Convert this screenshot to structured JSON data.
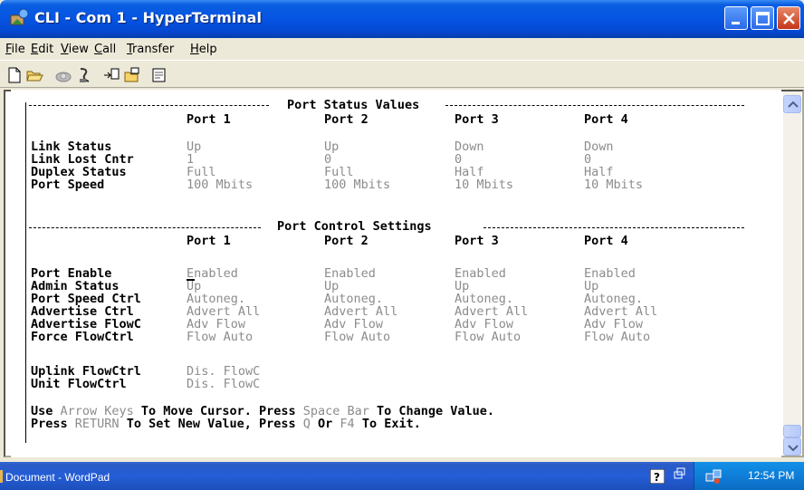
{
  "window": {
    "title": "CLI - Com 1 - HyperTerminal"
  },
  "menu": [
    {
      "label": "File",
      "key": "F",
      "rest": "ile"
    },
    {
      "label": "Edit",
      "key": "E",
      "rest": "dit"
    },
    {
      "label": "View",
      "key": "V",
      "rest": "iew"
    },
    {
      "label": "Call",
      "key": "C",
      "rest": "all"
    },
    {
      "label": "Transfer",
      "key": "T",
      "rest": "ransfer"
    },
    {
      "label": "Help",
      "key": "H",
      "rest": "elp"
    }
  ],
  "toolbar": {
    "icons": [
      "new-icon",
      "open-icon",
      "connect-icon",
      "disconnect-icon",
      "send-icon",
      "receive-icon",
      "properties-icon"
    ]
  },
  "terminal": {
    "status_header": "Port Status Values",
    "status_ports": [
      "Port 1",
      "Port 2",
      "Port 3",
      "Port 4"
    ],
    "status_rows": [
      {
        "label": "Link Status",
        "values": [
          "Up",
          "Up",
          "Down",
          "Down"
        ]
      },
      {
        "label": "Link Lost Cntr",
        "values": [
          "1",
          "0",
          "0",
          "0"
        ]
      },
      {
        "label": "Duplex Status",
        "values": [
          "Full",
          "Full",
          "Half",
          "Half"
        ]
      },
      {
        "label": "Port Speed",
        "values": [
          "100 Mbits",
          "100 Mbits",
          "10 Mbits",
          "10 Mbits"
        ]
      }
    ],
    "control_header": "Port Control Settings",
    "control_ports": [
      "Port 1",
      "Port 2",
      "Port 3",
      "Port 4"
    ],
    "control_rows": [
      {
        "label": "Port Enable",
        "values": [
          "Enabled",
          "Enabled",
          "Enabled",
          "Enabled"
        ]
      },
      {
        "label": "Admin Status",
        "values": [
          "Up",
          "Up",
          "Up",
          "Up"
        ]
      },
      {
        "label": "Port Speed Ctrl",
        "values": [
          "Autoneg.",
          "Autoneg.",
          "Autoneg.",
          "Autoneg."
        ]
      },
      {
        "label": "Advertise Ctrl",
        "values": [
          "Advert All",
          "Advert All",
          "Advert All",
          "Advert All"
        ]
      },
      {
        "label": "Advertise FlowC",
        "values": [
          "Adv Flow",
          "Adv Flow",
          "Adv Flow",
          "Adv Flow"
        ]
      },
      {
        "label": "Force FlowCtrl",
        "values": [
          "Flow Auto",
          "Flow Auto",
          "Flow Auto",
          "Flow Auto"
        ]
      }
    ],
    "uplink_rows": [
      {
        "label": "Uplink FlowCtrl",
        "value": "Dis. FlowC"
      },
      {
        "label": "Unit FlowCtrl",
        "value": "Dis. FlowC"
      }
    ],
    "help_line1": [
      {
        "text": "Use ",
        "dim": false
      },
      {
        "text": "Arrow Keys",
        "dim": true
      },
      {
        "text": " To Move Cursor. Press ",
        "dim": false
      },
      {
        "text": "Space Bar",
        "dim": true
      },
      {
        "text": " To Change Value.",
        "dim": false
      }
    ],
    "help_line2": [
      {
        "text": "Press ",
        "dim": false
      },
      {
        "text": "RETURN",
        "dim": true
      },
      {
        "text": " To Set New Value, Press ",
        "dim": false
      },
      {
        "text": "Q",
        "dim": true
      },
      {
        "text": " Or ",
        "dim": false
      },
      {
        "text": "F4",
        "dim": true
      },
      {
        "text": " To Exit.",
        "dim": false
      }
    ]
  },
  "taskbar": {
    "task_label": "Document - WordPad",
    "clock": "12:54 PM"
  }
}
